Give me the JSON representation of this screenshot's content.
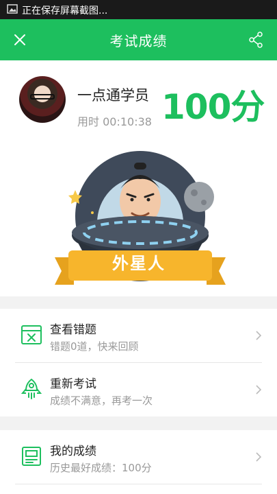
{
  "statusbar": {
    "text": "正在保存屏幕截图..."
  },
  "navbar": {
    "title": "考试成绩"
  },
  "profile": {
    "name": "一点通学员",
    "time": "用时 00:10:38",
    "score": "100分"
  },
  "badge": {
    "label": "外星人"
  },
  "menu": [
    {
      "title": "查看错题",
      "subtitle": "错题0道，快来回顾",
      "icon": "wrong-questions-icon"
    },
    {
      "title": "重新考试",
      "subtitle": "成绩不满意，再考一次",
      "icon": "rocket-icon"
    },
    {
      "title": "我的成绩",
      "subtitle": "历史最好成绩：100分",
      "icon": "score-report-icon"
    }
  ],
  "colors": {
    "accent": "#1dbf5e",
    "badge": "#f7b52c",
    "gap": "#f2f2f2"
  }
}
